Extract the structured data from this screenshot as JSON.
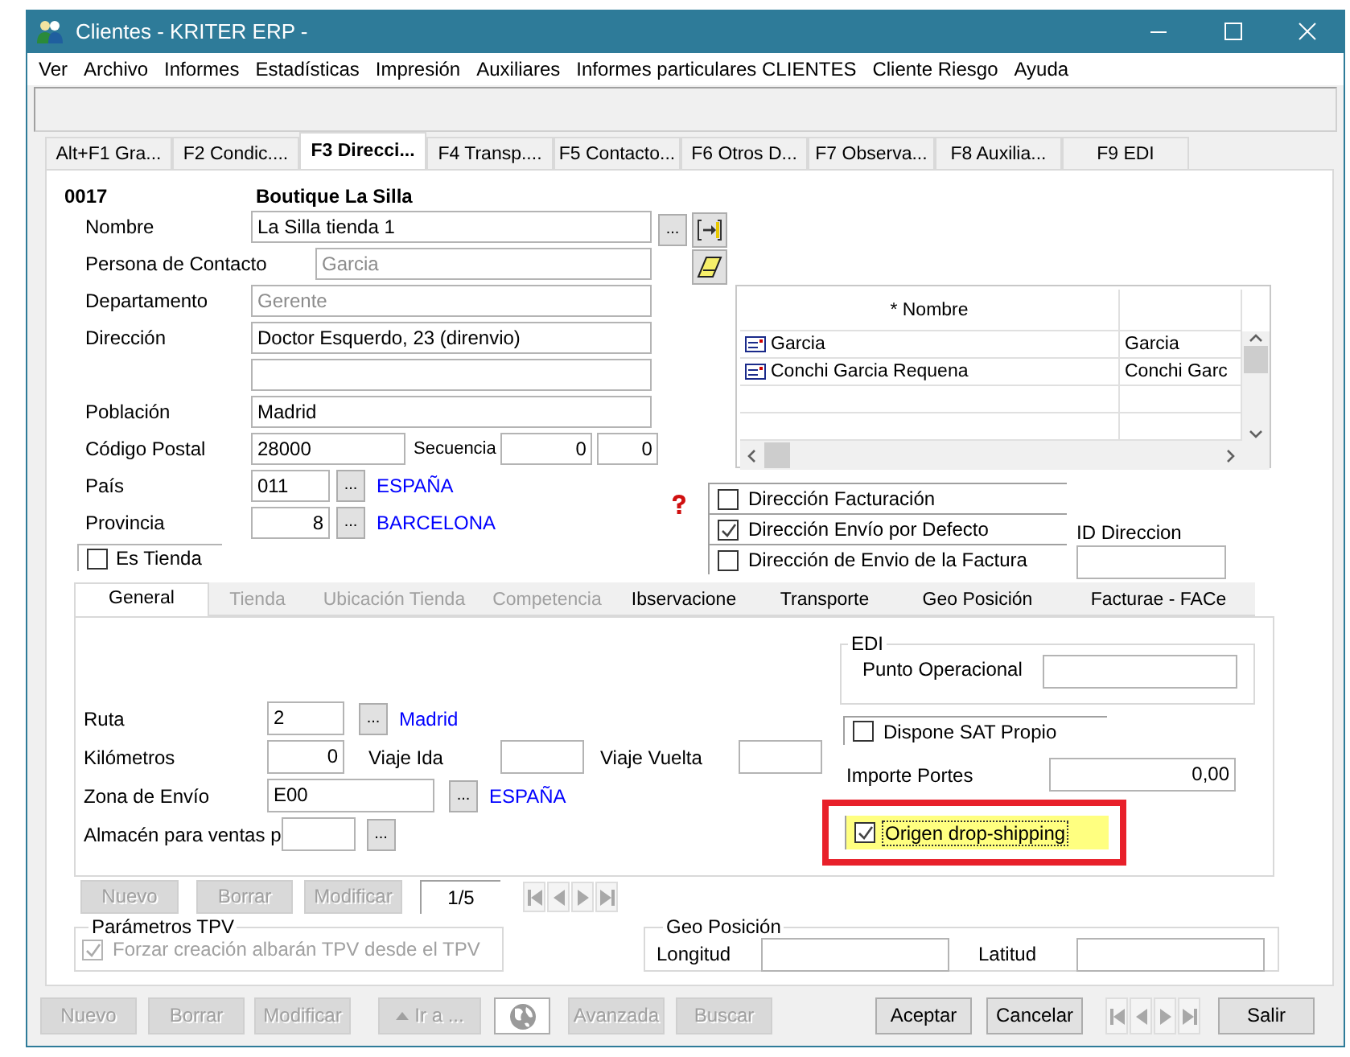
{
  "window": {
    "title": "Clientes - KRITER ERP -"
  },
  "menu": [
    "Ver",
    "Archivo",
    "Informes",
    "Estadísticas",
    "Impresión",
    "Auxiliares",
    "Informes particulares CLIENTES",
    "Cliente Riesgo",
    "Ayuda"
  ],
  "tabs": [
    {
      "label": "Alt+F1 Gra...",
      "selected": false
    },
    {
      "label": "F2 Condic....",
      "selected": false
    },
    {
      "label": "F3 Direcci...",
      "selected": true
    },
    {
      "label": "F4 Transp....",
      "selected": false
    },
    {
      "label": "F5 Contacto...",
      "selected": false
    },
    {
      "label": "F6 Otros D...",
      "selected": false
    },
    {
      "label": "F7 Observa...",
      "selected": false
    },
    {
      "label": "F8 Auxilia...",
      "selected": false
    },
    {
      "label": "F9 EDI",
      "selected": false
    }
  ],
  "form": {
    "code": "0017",
    "name": "Boutique La Silla",
    "name_button": "...",
    "rows": [
      {
        "kind": "text",
        "label": "Nombre",
        "value": "La Silla tienda 1",
        "readonly": false
      },
      {
        "kind": "offset",
        "label": "Persona de Contacto",
        "value": "Garcia",
        "readonly": true
      },
      {
        "kind": "text",
        "label": "Departamento",
        "value": "Gerente",
        "readonly": true
      },
      {
        "kind": "text",
        "label": "Dirección",
        "value": "Doctor Esquerdo, 23 (direnvio)",
        "readonly": false
      },
      {
        "kind": "text"
      },
      {
        "kind": "text",
        "label": "Población",
        "value": "Madrid",
        "readonly": false
      },
      {
        "kind": "postal",
        "label": "Código Postal",
        "value": "28000",
        "sequence_label": "Secuencia",
        "sequence": [
          "0",
          "0"
        ]
      },
      {
        "kind": "lookup",
        "label": "País",
        "code": "011",
        "numeric": false,
        "button": "...",
        "description": "ESPAÑA"
      },
      {
        "kind": "lookup",
        "label": "Provincia",
        "code": "8",
        "numeric": true,
        "button": "...",
        "description": "BARCELONA"
      }
    ],
    "es_tienda": {
      "label": "Es Tienda",
      "checked": false
    }
  },
  "contacts_grid": {
    "columns": [
      "* Nombre"
    ],
    "rows": [
      {
        "name": "Garcia",
        "column_2": "Garcia"
      },
      {
        "name": "Conchi Garcia Requena",
        "column_2": "Conchi Garc"
      }
    ]
  },
  "address_flags": [
    {
      "label": "Dirección Facturación",
      "checked": false
    },
    {
      "label": "Dirección Envío por Defecto",
      "checked": true
    },
    {
      "label": "Dirección de Envio de la Factura",
      "checked": false
    }
  ],
  "id_direccion": {
    "label": "ID Direccion"
  },
  "sub_tabs": [
    {
      "label": "General",
      "selected": true,
      "disabled": false
    },
    {
      "label": "Tienda",
      "selected": false,
      "disabled": true
    },
    {
      "label": "Ubicación Tienda",
      "selected": false,
      "disabled": true
    },
    {
      "label": "Competencia",
      "selected": false,
      "disabled": true
    },
    {
      "label": "Ibservacione",
      "selected": false,
      "disabled": false
    },
    {
      "label": "Transporte",
      "selected": false,
      "disabled": false
    },
    {
      "label": "Geo Posición",
      "selected": false,
      "disabled": false
    },
    {
      "label": "Facturae - FACe",
      "selected": false,
      "disabled": false
    }
  ],
  "general": {
    "edi": {
      "title": "EDI",
      "label": "Punto Operacional"
    },
    "ruta": {
      "label": "Ruta",
      "value": "2",
      "button": "...",
      "description": "Madrid"
    },
    "kilometros": {
      "label": "Kilómetros",
      "value": "0",
      "ida_label": "Viaje Ida",
      "vuelta_label": "Viaje Vuelta"
    },
    "zona": {
      "label": "Zona de Envío",
      "value": "E00",
      "button": "...",
      "description": "ESPAÑA"
    },
    "almacen": {
      "label": "Almacén para ventas p",
      "button": "..."
    },
    "sat": {
      "label": "Dispone SAT Propio",
      "checked": false
    },
    "portes": {
      "label": "Importe Portes",
      "value": "0,00"
    },
    "drop_shipping": {
      "label": "Origen drop-shipping",
      "checked": true,
      "highlighted": true
    }
  },
  "record_bar": {
    "buttons": [
      {
        "label": "Nuevo",
        "disabled": true
      },
      {
        "label": "Borrar",
        "disabled": true
      },
      {
        "label": "Modificar",
        "disabled": true
      }
    ],
    "counter": "1/5",
    "navigator_disabled": true
  },
  "tpv": {
    "title": "Parámetros TPV",
    "option": {
      "label": "Forzar creación albarán TPV desde el TPV",
      "checked": true,
      "disabled": true
    }
  },
  "geo": {
    "title": "Geo Posición",
    "fields": [
      "Longitud",
      "Latitud"
    ]
  },
  "bottom_buttons": [
    {
      "kind": "text",
      "label": "Nuevo",
      "disabled": true
    },
    {
      "kind": "text",
      "label": "Borrar",
      "disabled": true
    },
    {
      "kind": "text",
      "label": "Modificar",
      "disabled": true
    },
    {
      "kind": "goto",
      "label": "Ir a ...",
      "disabled": true
    },
    {
      "kind": "globe",
      "disabled": false
    },
    {
      "kind": "text",
      "label": "Avanzada",
      "disabled": true
    },
    {
      "kind": "text",
      "label": "Buscar",
      "disabled": true
    },
    {
      "kind": "text",
      "label": "Aceptar",
      "disabled": false
    },
    {
      "kind": "text",
      "label": "Cancelar",
      "disabled": false
    },
    {
      "kind": "nav",
      "disabled": true
    },
    {
      "kind": "text",
      "label": "Salir",
      "disabled": false
    }
  ]
}
